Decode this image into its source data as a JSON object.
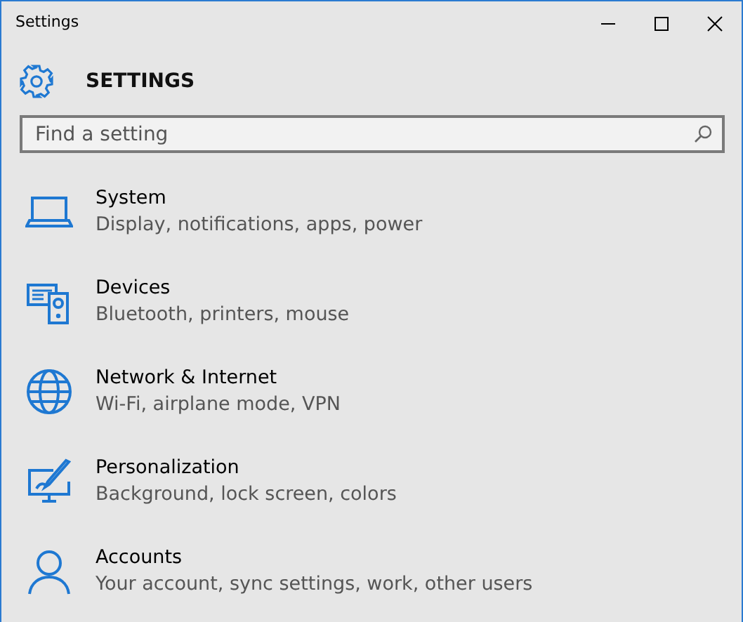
{
  "window": {
    "title": "Settings"
  },
  "header": {
    "title": "SETTINGS"
  },
  "search": {
    "placeholder": "Find a setting"
  },
  "categories": [
    {
      "kind": "system",
      "name": "System",
      "description": "Display, notifications, apps, power"
    },
    {
      "kind": "devices",
      "name": "Devices",
      "description": "Bluetooth, printers, mouse"
    },
    {
      "kind": "network",
      "name": "Network & Internet",
      "description": "Wi-Fi, airplane mode, VPN"
    },
    {
      "kind": "personalization",
      "name": "Personalization",
      "description": "Background, lock screen, colors"
    },
    {
      "kind": "accounts",
      "name": "Accounts",
      "description": "Your account, sync settings, work, other users"
    }
  ]
}
